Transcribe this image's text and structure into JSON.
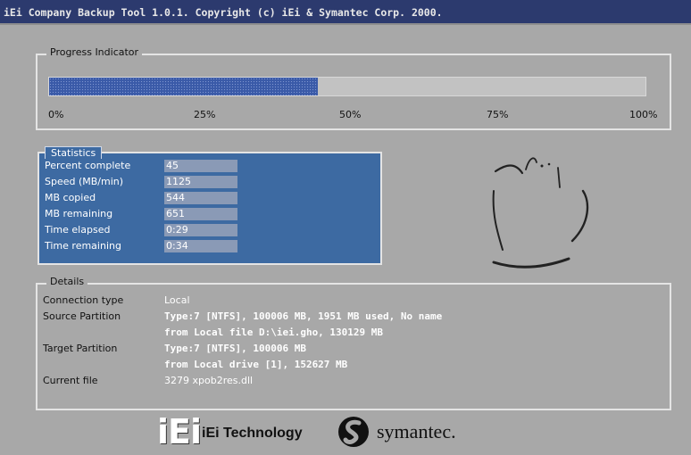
{
  "title": "iEi Company Backup Tool 1.0.1.  Copyright (c) iEi & Symantec Corp. 2000.",
  "progress": {
    "label": "Progress Indicator",
    "percent": 45,
    "ticks": [
      "0%",
      "25%",
      "50%",
      "75%",
      "100%"
    ]
  },
  "statistics": {
    "label": "Statistics",
    "rows": [
      {
        "label": "Percent complete",
        "value": "45"
      },
      {
        "label": "Speed (MB/min)",
        "value": "1125"
      },
      {
        "label": "MB copied",
        "value": "544"
      },
      {
        "label": "MB remaining",
        "value": "651"
      },
      {
        "label": "Time elapsed",
        "value": "0:29"
      },
      {
        "label": "Time remaining",
        "value": "0:34"
      }
    ]
  },
  "details": {
    "label": "Details",
    "connection_type_label": "Connection type",
    "connection_type": "Local",
    "source_label": "Source Partition",
    "source_line1": "Type:7 [NTFS], 100006 MB, 1951 MB used, No name",
    "source_line2": "from Local file D:\\iei.gho, 130129 MB",
    "target_label": "Target Partition",
    "target_line1": "Type:7 [NTFS], 100006 MB",
    "target_line2": "from Local drive [1], 152627 MB",
    "current_file_label": "Current file",
    "current_file": "3279 xpob2res.dll"
  },
  "logos": {
    "iei_letters": "iEi",
    "iei_text": "iEi Technology",
    "symantec_text": "symantec."
  },
  "colors": {
    "title_bar": "#2c3a6e",
    "progress_fill": "#3a5aa8",
    "stats_panel": "#3d6aa2",
    "background": "#a8a8a8"
  }
}
